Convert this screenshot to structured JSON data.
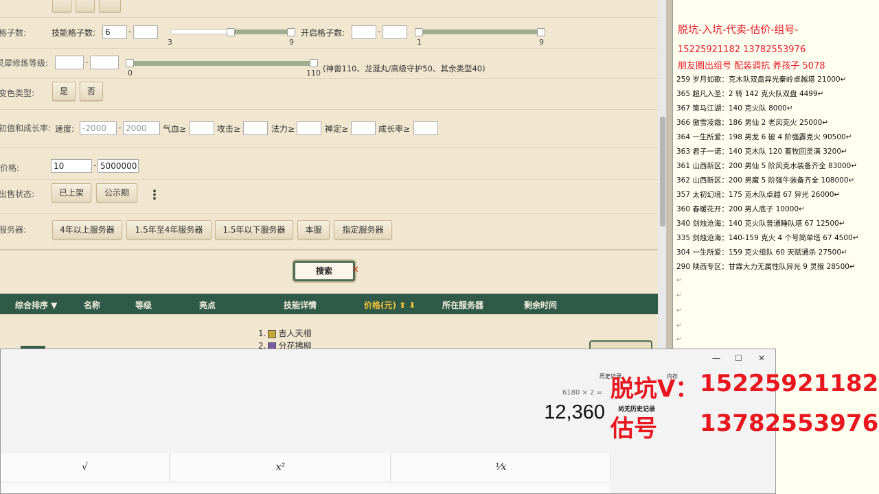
{
  "filters": {
    "grid_row": {
      "label": "格子数:",
      "skill_grid_label": "技能格子数:",
      "skill_grid_min": "6",
      "skill_grid_max": "",
      "skill_slider_min": "3",
      "skill_slider_max": "9",
      "open_grid_label": "开启格子数:",
      "open_grid_min": "",
      "open_grid_max": "",
      "open_slider_min": "1",
      "open_slider_max": "9"
    },
    "spirit_row": {
      "label": "灵犀修炼等级:",
      "min": "",
      "max": "",
      "slider_min": "0",
      "slider_max": "110",
      "note": "(神兽110、龙涎丸/高级守护50、其余类型40)"
    },
    "color_row": {
      "label": "变色类型:",
      "yes": "是",
      "no": "否"
    },
    "stats_row": {
      "label": "初值和成长率:",
      "speed_label": "速度:",
      "speed_min": "-2000",
      "speed_max": "2000",
      "hp_label": "气血≥",
      "atk_label": "攻击≥",
      "mag_label": "法力≥",
      "def_label": "禅定≥",
      "growth_label": "成长率≥"
    },
    "price_row": {
      "label": "价格:",
      "min": "10",
      "max": "5000000"
    },
    "sale_row": {
      "label": "出售状态:",
      "listed": "已上架",
      "public": "公示期",
      "more": "⋮"
    },
    "server_row": {
      "label": "服务器:",
      "buttons": [
        "4年以上服务器",
        "1.5年至4年服务器",
        "1.5年以下服务器",
        "本服",
        "指定服务器"
      ]
    },
    "search_label": "搜索"
  },
  "table": {
    "headers": [
      "综合排序 ▼",
      "名称",
      "等级",
      "亮点",
      "技能详情",
      "价格(元) ⬆ ⬇",
      "所在服务器",
      "剩余时间"
    ],
    "skills": [
      "1.",
      "吉人天相",
      "2.",
      "分花拂柳"
    ]
  },
  "notes": {
    "title": "脱坑-入坑-代卖-估价-组号-",
    "phones": "15225921182    13782553976",
    "services": "朋友圈出组号   配装调抗  养孩子 5078",
    "entries": [
      "259 岁月如歌：克木队双盘异光秦岭卓越塔 21000↵",
      "365 超凡入圣：2 转 142 克火队双盘 4499↵",
      "367 策马江湖：140 克火队 8000↵",
      "366 傲雪凌霜：186 男仙 2 老风克火 25000↵",
      "364 一生所爱：198 男龙 6 破 4 阶强霹克火 90500↵",
      "363 君子一诺：140 克木队 120 畜牧回灵满 3200↵",
      "361 山西新区：200 男仙 5 阶风克水装备齐全 83000↵",
      "362 山西新区：200 男魔 5 阶强牛装备齐全 108000↵",
      "357 太初幻境：175 克木队卓越 67 异光 26000↵",
      "360 春暖花开：200 男人底子 10000↵",
      "340 剑烛沧海：140 克火队普通睡队塔 67  12500↵",
      "335 剑烛沧海：140-159 克火 4 个号简单塔 67  4500↵",
      "304 一生所爱：159 克火组队 60 天赋通杀 27500↵",
      "290 陕西专区：甘霖大力无属性队异光 9 灵猴 28500↵"
    ]
  },
  "calculator": {
    "expression": "6180 × 2 =",
    "result": "12,360",
    "history_title": "历史记录",
    "memory_title": "内存",
    "history_empty": "尚无历史记录",
    "keys": [
      "√",
      "x²",
      "¹⁄x"
    ],
    "window_controls": [
      "—",
      "☐",
      "✕"
    ]
  },
  "overlay": {
    "line1_label": "脱坑V：",
    "line1_value": "15225921182",
    "line2_label": "估号",
    "line2_value": "13782553976"
  },
  "colors": {
    "accent_red": "#e4192a",
    "header_green": "#2e5a47",
    "panel_bg": "#f1e6cf",
    "price_header": "#f5c13a"
  }
}
